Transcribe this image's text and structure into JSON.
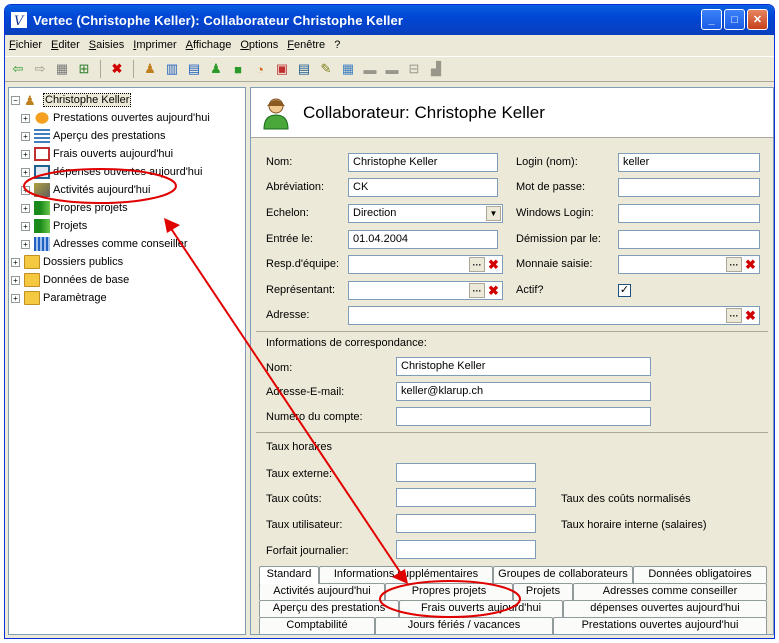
{
  "window": {
    "title": "Vertec (Christophe Keller): Collaborateur Christophe Keller"
  },
  "menu": [
    "Fichier",
    "Editer",
    "Saisies",
    "Imprimer",
    "Affichage",
    "Options",
    "Fenêtre",
    "?"
  ],
  "tree": {
    "root": "Christophe Keller",
    "children": [
      "Prestations ouvertes aujourd'hui",
      "Aperçu des prestations",
      "Frais ouverts aujourd'hui",
      "dépenses ouvertes aujourd'hui",
      "Activités aujourd'hui",
      "Propres projets",
      "Projets",
      "Adresses comme conseiller"
    ],
    "top": [
      "Dossiers publics",
      "Données de base",
      "Paramètrage"
    ]
  },
  "header": {
    "title": "Collaborateur: Christophe Keller"
  },
  "form": {
    "nom_label": "Nom:",
    "nom_value": "Christophe Keller",
    "abrev_label": "Abréviation:",
    "abrev_value": "CK",
    "echelon_label": "Echelon:",
    "echelon_value": "Direction",
    "entree_label": "Entrée le:",
    "entree_value": "01.04.2004",
    "resp_label": "Resp.d'équipe:",
    "repr_label": "Représentant:",
    "adresse_label": "Adresse:",
    "login_label": "Login (nom):",
    "login_value": "keller",
    "mdp_label": "Mot de passe:",
    "winlogin_label": "Windows Login:",
    "demission_label": "Démission par le:",
    "monnaie_label": "Monnaie saisie:",
    "actif_label": "Actif?",
    "actif_mark": "✓"
  },
  "corr": {
    "title": "Informations de correspondance:",
    "nom_label": "Nom:",
    "nom_value": "Christophe Keller",
    "email_label": "Adresse-E-mail:",
    "email_value": "keller@klarup.ch",
    "compte_label": "Numéro du compte:"
  },
  "taux": {
    "title": "Taux horaires",
    "externe_label": "Taux externe:",
    "couts_label": "Taux coûts:",
    "utilisateur_label": "Taux utilisateur:",
    "forfait_label": "Forfait journalier:",
    "normalises_label": "Taux des coûts normalisés",
    "interne_label": "Taux horaire interne (salaires)"
  },
  "tabs": {
    "row1": [
      "Comptabilité",
      "Jours fériés / vacances",
      "Prestations ouvertes aujourd'hui"
    ],
    "row2": [
      "Aperçu des prestations",
      "Frais ouverts aujourd'hui",
      "dépenses ouvertes aujourd'hui"
    ],
    "row3": [
      "Activités aujourd'hui",
      "Propres projets",
      "Projets",
      "Adresses comme conseiller"
    ],
    "row4": [
      "Standard",
      "Informations supplémentaires",
      "Groupes de collaborateurs",
      "Données obligatoires"
    ]
  },
  "colors": {
    "annotation": "#e00000",
    "titlebar": "#0046d5"
  }
}
